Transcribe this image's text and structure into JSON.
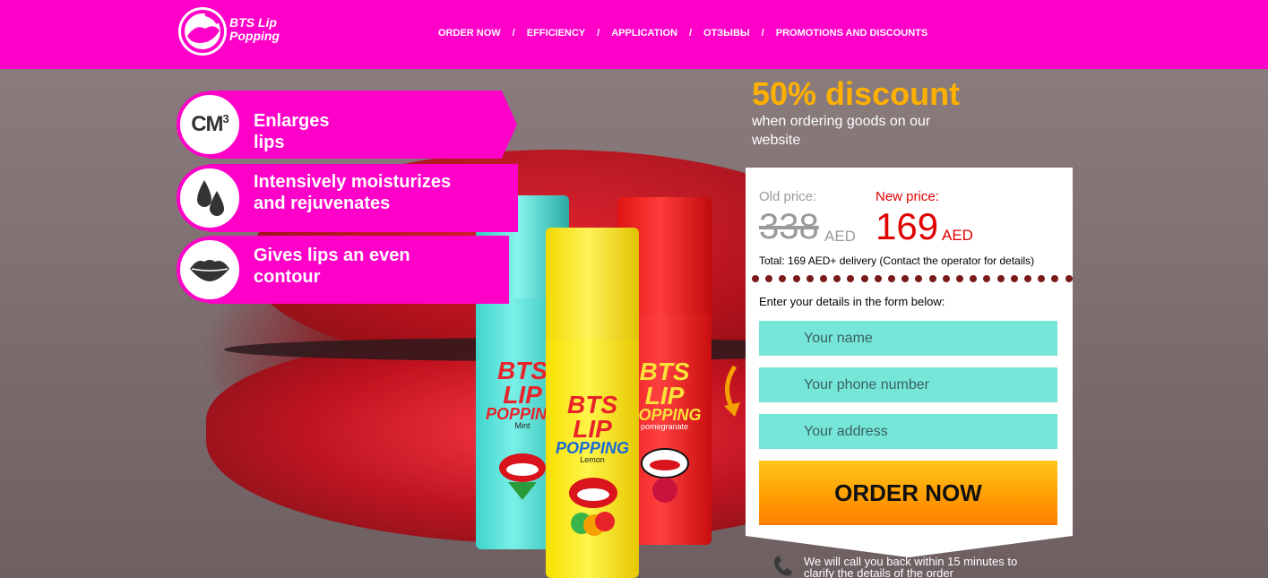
{
  "colors": {
    "brand": "#ff00c8",
    "discount": "#ffb000",
    "new_price": "#e00000",
    "field": "#76e6d8",
    "button": "#ff9a00"
  },
  "header": {
    "logo_line1": "BTS Lip",
    "logo_line2": "Popping",
    "nav": [
      "ORDER NOW",
      "EFFICIENCY",
      "APPLICATION",
      "ОТЗЫВЫ",
      "PROMOTIONS AND DISCOUNTS"
    ],
    "separator": "/"
  },
  "features": [
    {
      "icon": "cm3-icon",
      "icon_text": "CM",
      "icon_sup": "3",
      "label": "Enlarges lips"
    },
    {
      "icon": "drops-icon",
      "label": "Intensively moisturizes and rejuvenates"
    },
    {
      "icon": "lips-icon",
      "label": "Gives lips an even contour"
    }
  ],
  "products": [
    {
      "brand": "BTS LIP",
      "line": "POPPING",
      "flavor": "Mint"
    },
    {
      "brand": "BTS LIP",
      "line": "POPPING",
      "flavor": "Lemon"
    },
    {
      "brand": "BTS LIP",
      "line": "POPPING",
      "flavor": "pomegranate"
    }
  ],
  "discount": {
    "title": "50% discount",
    "subtitle": "when ordering goods on our website"
  },
  "order": {
    "old_label": "Old price:",
    "old_price": "338",
    "old_currency": "AED",
    "new_label": "New price:",
    "new_price": "169",
    "new_currency": "AED",
    "total": "Total: 169 AED+ delivery (Contact the operator for details)",
    "form_label": "Enter your details in the form below:",
    "name_placeholder": "Your name",
    "phone_placeholder": "Your phone number",
    "address_placeholder": "Your address",
    "button": "ORDER NOW",
    "callback": "We will call you back within 15 minutes to clarify the details of the order"
  }
}
